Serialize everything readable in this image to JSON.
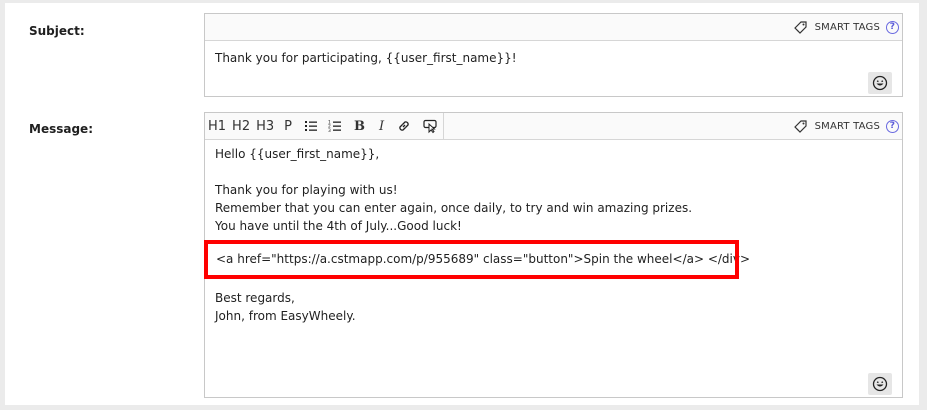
{
  "subject": {
    "label": "Subject:",
    "smart_tags_label": "SMART TAGS",
    "help_glyph": "?",
    "value": "Thank you for participating, {{user_first_name}}!",
    "emoji_icon": "emoji-face-icon"
  },
  "message": {
    "label": "Message:",
    "smart_tags_label": "SMART TAGS",
    "help_glyph": "?",
    "toolbar": {
      "h1": "H1",
      "h2": "H2",
      "h3": "H3",
      "p": "P",
      "bold": "B",
      "italic": "I"
    },
    "lines": {
      "greeting": "Hello {{user_first_name}},",
      "body1": "Thank you for playing with us!",
      "body2": "Remember that you can enter again, once daily, to try and win amazing prizes.",
      "body3": "You have until the 4th of July...Good luck!",
      "code": "<a href=\"https://a.cstmapp.com/p/955689\" class=\"button\">Spin the wheel</a> </div>",
      "closing1": "Best regards,",
      "closing2": "John, from EasyWheely."
    },
    "highlight_color": "#ff0000"
  }
}
